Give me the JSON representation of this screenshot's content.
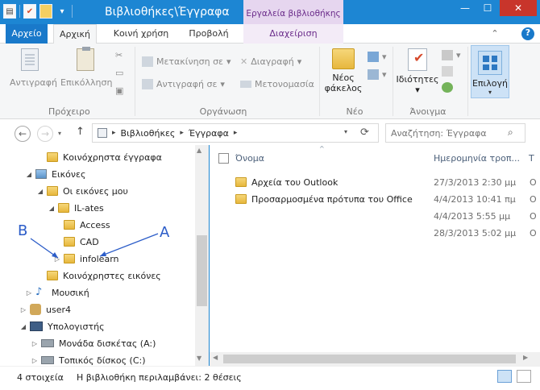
{
  "window": {
    "title": "Βιβλιοθήκες\\Έγγραφα",
    "contextual_tab_title": "Εργαλεία βιβλιοθήκης",
    "minimize_icon": "minimize-icon",
    "maximize_icon": "maximize-icon",
    "close_icon": "close-icon"
  },
  "tabs": {
    "file": "Αρχείο",
    "home": "Αρχική",
    "share": "Κοινή χρήση",
    "view": "Προβολή",
    "manage": "Διαχείριση",
    "help": "?"
  },
  "ribbon": {
    "clipboard": {
      "label": "Πρόχειρο",
      "copy": "Αντιγραφή",
      "paste": "Επικόλληση"
    },
    "organize": {
      "label": "Οργάνωση",
      "move_to": "Μετακίνηση σε",
      "copy_to": "Αντιγραφή σε",
      "delete": "Διαγραφή",
      "rename": "Μετονομασία"
    },
    "new": {
      "label": "Νέο",
      "new_folder_line1": "Νέος",
      "new_folder_line2": "φάκελος"
    },
    "open": {
      "label": "Άνοιγμα",
      "properties": "Ιδιότητες"
    },
    "select": {
      "label": "Επιλογή"
    }
  },
  "address": {
    "crumbs": [
      "Βιβλιοθήκες",
      "Έγγραφα"
    ],
    "search_placeholder": "Αναζήτηση: Έγγραφα"
  },
  "tree": [
    {
      "label": "Κοινόχρηστα έγγραφα",
      "icon": "folder-icon"
    },
    {
      "label": "Εικόνες",
      "icon": "pictures-icon"
    },
    {
      "label": "Οι εικόνες μου",
      "icon": "folder-icon"
    },
    {
      "label": "IL-ates",
      "icon": "folder-icon"
    },
    {
      "label": "Access",
      "icon": "folder-icon"
    },
    {
      "label": "CAD",
      "icon": "folder-icon"
    },
    {
      "label": "infolearn",
      "icon": "folder-icon"
    },
    {
      "label": "Κοινόχρηστες εικόνες",
      "icon": "folder-icon"
    },
    {
      "label": "Μουσική",
      "icon": "music-icon"
    },
    {
      "label": "user4",
      "icon": "user-icon"
    },
    {
      "label": "Υπολογιστής",
      "icon": "computer-icon"
    },
    {
      "label": "Μονάδα δισκέτας (A:)",
      "icon": "floppy-icon"
    },
    {
      "label": "Τοπικός δίσκος (C:)",
      "icon": "drive-icon"
    }
  ],
  "columns": {
    "name": "Όνομα",
    "date": "Ημερομηνία τροπ...",
    "type_clip": "Τ"
  },
  "files": [
    {
      "name": "Αρχεία του Outlook",
      "date": "27/3/2013 2:30 μμ",
      "clip": "Ο"
    },
    {
      "name": "Προσαρμοσμένα πρότυπα του Office",
      "date": "4/4/2013 10:41 πμ",
      "clip": "Ο"
    },
    {
      "name": "",
      "date": "4/4/2013 5:55 μμ",
      "clip": "Ο"
    },
    {
      "name": "",
      "date": "28/3/2013 5:02 μμ",
      "clip": "Ο"
    }
  ],
  "status": {
    "count": "4 στοιχεία",
    "library_info": "Η βιβλιοθήκη περιλαμβάνει: 2 θέσεις"
  },
  "annotations": {
    "a": "A",
    "b": "B",
    "color": "#2b5cc8"
  }
}
